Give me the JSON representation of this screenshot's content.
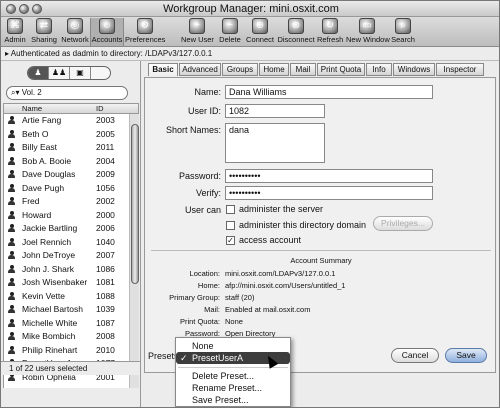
{
  "window": {
    "title": "Workgroup Manager: mini.osxit.com"
  },
  "toolbar": {
    "items": [
      {
        "label": "Admin"
      },
      {
        "label": "Sharing"
      },
      {
        "label": "Network"
      },
      {
        "label": "Accounts"
      },
      {
        "label": "Preferences"
      },
      {
        "label": "New User"
      },
      {
        "label": "Delete"
      },
      {
        "label": "Connect"
      },
      {
        "label": "Disconnect"
      },
      {
        "label": "Refresh"
      },
      {
        "label": "New Window"
      },
      {
        "label": "Search"
      }
    ]
  },
  "auth": {
    "text": "Authenticated as dadmin to directory: /LDAPv3/127.0.0.1"
  },
  "sidebar": {
    "search_value": "Vol. 2",
    "columns": {
      "name": "Name",
      "id": "ID"
    },
    "users": [
      {
        "name": "Artie Fang",
        "id": "2003"
      },
      {
        "name": "Beth O",
        "id": "2005"
      },
      {
        "name": "Billy East",
        "id": "2011"
      },
      {
        "name": "Bob A. Booie",
        "id": "2004"
      },
      {
        "name": "Dave Douglas",
        "id": "2009"
      },
      {
        "name": "Dave Pugh",
        "id": "1056"
      },
      {
        "name": "Fred",
        "id": "2002"
      },
      {
        "name": "Howard",
        "id": "2000"
      },
      {
        "name": "Jackie Bartling",
        "id": "2006"
      },
      {
        "name": "Joel Rennich",
        "id": "1040"
      },
      {
        "name": "John DeTroye",
        "id": "2007"
      },
      {
        "name": "John J. Shark",
        "id": "1086"
      },
      {
        "name": "Josh Wisenbaker",
        "id": "1081"
      },
      {
        "name": "Kevin Vette",
        "id": "1088"
      },
      {
        "name": "Michael Bartosh",
        "id": "1039"
      },
      {
        "name": "Michelle White",
        "id": "1087"
      },
      {
        "name": "Mike Bombich",
        "id": "2008"
      },
      {
        "name": "Philip Rinehart",
        "id": "2010"
      },
      {
        "name": "PresetUser A",
        "id": "1077"
      },
      {
        "name": "Robin Ophelia",
        "id": "2001"
      }
    ],
    "status": "1 of 22 users selected"
  },
  "tabs": [
    "Basic",
    "Advanced",
    "Groups",
    "Home",
    "Mail",
    "Print Quota",
    "Info",
    "Windows",
    "Inspector"
  ],
  "form": {
    "name_label": "Name:",
    "name_value": "Dana Williams",
    "userid_label": "User ID:",
    "userid_value": "1082",
    "short_label": "Short Names:",
    "short_value": "dana",
    "password_label": "Password:",
    "password_value": "••••••••••",
    "verify_label": "Verify:",
    "verify_value": "••••••••••",
    "usercan_label": "User can",
    "admin_server": "administer the server",
    "admin_domain": "administer this directory domain",
    "privileges": "Privileges...",
    "access": "access account"
  },
  "summary": {
    "title": "Account Summary",
    "rows": [
      {
        "k": "Location:",
        "v": "mini.osxit.com/LDAPv3/127.0.0.1"
      },
      {
        "k": "Home:",
        "v": "afp://mini.osxit.com/Users/untitled_1"
      },
      {
        "k": "Primary Group:",
        "v": "staff (20)"
      },
      {
        "k": "Mail:",
        "v": "Enabled at mail.osxit.com"
      },
      {
        "k": "Print Quota:",
        "v": "None"
      },
      {
        "k": "Password:",
        "v": "Open Directory"
      }
    ]
  },
  "bottom": {
    "presets_label": "Presets",
    "cancel": "Cancel",
    "save": "Save"
  },
  "presets_menu": {
    "items": [
      "None",
      "PresetUserA",
      "Delete Preset...",
      "Rename Preset...",
      "Save Preset..."
    ],
    "checked": "✓"
  }
}
